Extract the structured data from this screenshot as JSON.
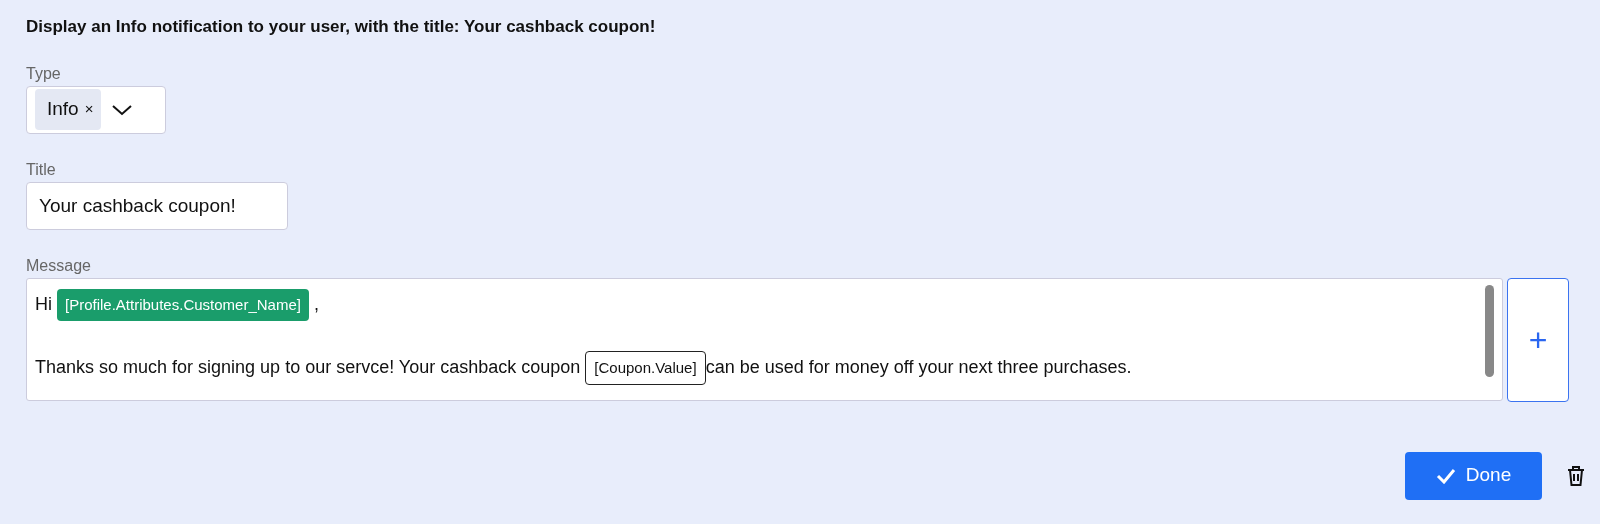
{
  "heading": "Display an Info notification to your user, with the title: Your cashback coupon!",
  "type_field": {
    "label": "Type",
    "chips": [
      {
        "label": "Info",
        "remove": "×"
      }
    ]
  },
  "title_field": {
    "label": "Title",
    "value": "Your cashback coupon!"
  },
  "message_field": {
    "label": "Message",
    "add_button": "+",
    "paragraphs": [
      [
        {
          "kind": "text",
          "text": "Hi "
        },
        {
          "kind": "tag",
          "text": "[Profile.Attributes.Customer_Name]"
        },
        {
          "kind": "text",
          "text": " ,"
        }
      ],
      [
        {
          "kind": "text",
          "text": "Thanks so much for signing up to our servce! Your cashback coupon "
        },
        {
          "kind": "slot",
          "text": "[Coupon.Value]"
        },
        {
          "kind": "text",
          "text": "can be used for money off your next three purchases."
        }
      ]
    ]
  },
  "actions": {
    "done": "Done"
  }
}
